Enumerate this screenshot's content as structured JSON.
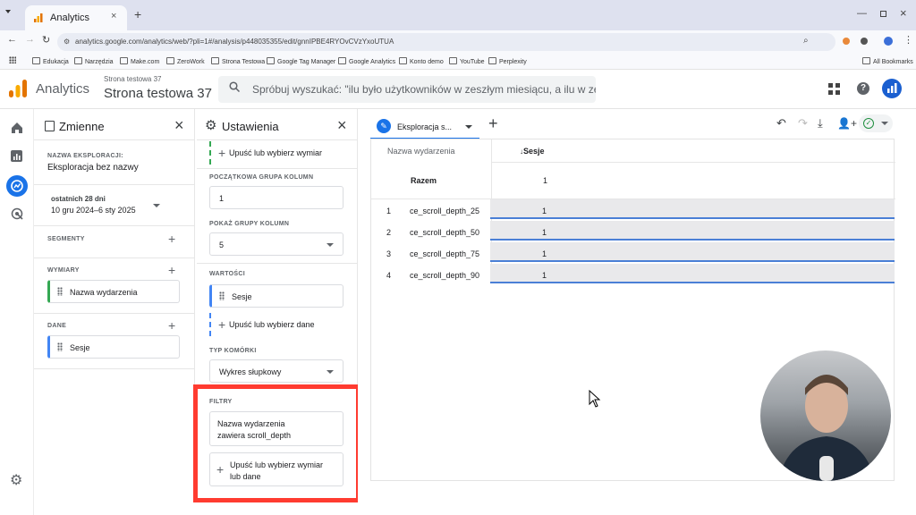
{
  "browser": {
    "tab_title": "Analytics",
    "url": "analytics.google.com/analytics/web/?pli=1#/analysis/p448035355/edit/gnnIPBE4RYOvCVzYxoUTUA",
    "bookmarks": [
      "Edukacja",
      "Narzędzia",
      "Make.com",
      "ZeroWork",
      "Strona Testowa",
      "Google Tag Manager",
      "Google Analytics",
      "Konto demo",
      "YouTube",
      "Perplexity"
    ],
    "all_bookmarks": "All Bookmarks"
  },
  "header": {
    "app_name": "Analytics",
    "account": "Strona testowa 37",
    "property": "Strona testowa 37",
    "search_placeholder": "Spróbuj wyszukać: \"ilu było użytkowników w zeszłym miesiącu, a ilu w ze..."
  },
  "variables": {
    "title": "Zmienne",
    "exploration_name_label": "NAZWA EKSPLORACJI:",
    "exploration_name": "Eksploracja bez nazwy",
    "date_range_label": "ostatnich 28 dni",
    "date_range": "10 gru 2024–6 sty 2025",
    "segments_label": "SEGMENTY",
    "dimensions_label": "WYMIARY",
    "dimension_item": "Nazwa wydarzenia",
    "metrics_label": "DANE",
    "metric_item": "Sesje"
  },
  "settings": {
    "title": "Ustawienia",
    "drop_dimension": "Upuść lub wybierz wymiar",
    "start_col_group_label": "POCZĄTKOWA GRUPA KOLUMN",
    "start_col_group": "1",
    "show_col_groups_label": "POKAŻ GRUPY KOLUMN",
    "show_col_groups": "5",
    "values_label": "WARTOŚCI",
    "value_item": "Sesje",
    "drop_data": "Upuść lub wybierz dane",
    "cell_type_label": "TYP KOMÓRKI",
    "cell_type": "Wykres słupkowy",
    "filters_label": "FILTRY",
    "filter_line1": "Nazwa wydarzenia",
    "filter_line2": "zawiera scroll_depth",
    "drop_filter_line1": "Upuść lub wybierz wymiar",
    "drop_filter_line2": "lub dane"
  },
  "exploration": {
    "tab_label": "Eksploracja s...",
    "col_dimension": "Nazwa wydarzenia",
    "col_metric": "Sesje",
    "total_label": "Razem",
    "total_value": "1",
    "rows": [
      {
        "num": "1",
        "name": "ce_scroll_depth_25",
        "value": "1"
      },
      {
        "num": "2",
        "name": "ce_scroll_depth_50",
        "value": "1"
      },
      {
        "num": "3",
        "name": "ce_scroll_depth_75",
        "value": "1"
      },
      {
        "num": "4",
        "name": "ce_scroll_depth_90",
        "value": "1"
      }
    ]
  },
  "colors": {
    "accent": "#1a73e8",
    "highlight": "#ff3b30",
    "bar_fill": "#e9e9eb",
    "bar_line": "#4a7fd6"
  }
}
